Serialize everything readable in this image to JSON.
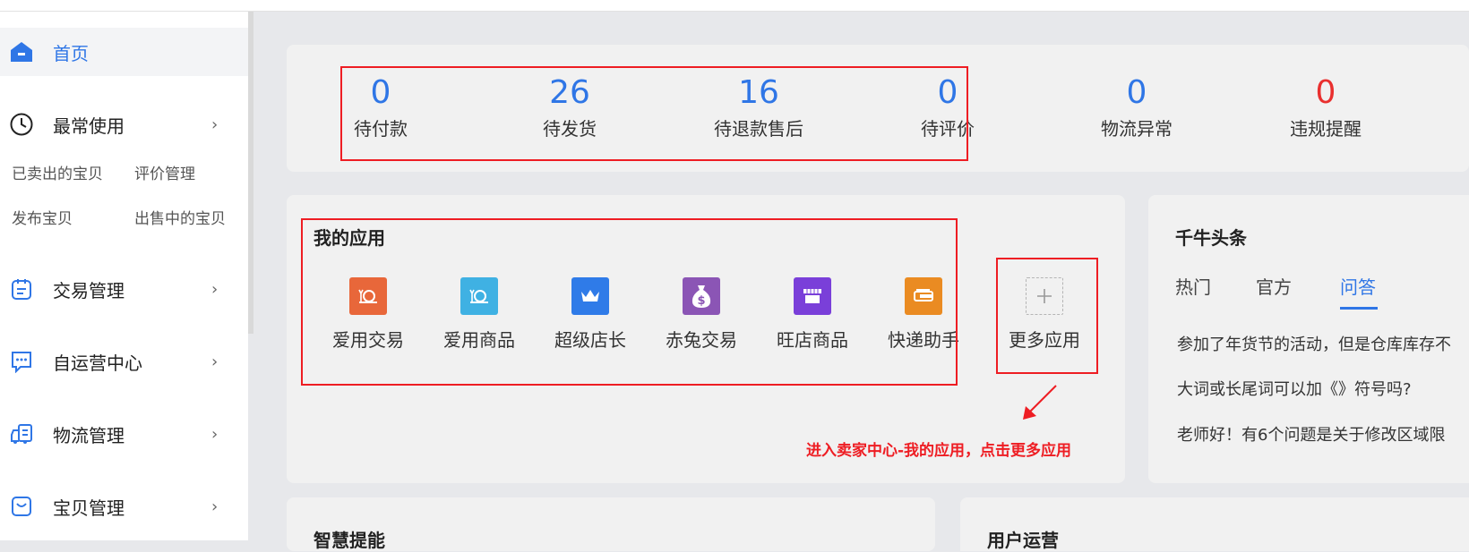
{
  "sidebar": {
    "home": "首页",
    "frequent": "最常使用",
    "quick_links": [
      "已卖出的宝贝",
      "评价管理",
      "发布宝贝",
      "出售中的宝贝"
    ],
    "trade": "交易管理",
    "self_ops": "自运营中心",
    "logistics": "物流管理",
    "goods": "宝贝管理",
    "chevron": "›"
  },
  "stats": [
    {
      "value": "0",
      "label": "待付款"
    },
    {
      "value": "26",
      "label": "待发货"
    },
    {
      "value": "16",
      "label": "待退款售后"
    },
    {
      "value": "0",
      "label": "待评价"
    },
    {
      "value": "0",
      "label": "物流异常"
    },
    {
      "value": "0",
      "label": "违规提醒"
    }
  ],
  "apps": {
    "title": "我的应用",
    "items": [
      "爱用交易",
      "爱用商品",
      "超级店长",
      "赤兔交易",
      "旺店商品",
      "快递助手",
      "更多应用"
    ],
    "colors": [
      "#e8673a",
      "#3fb1e3",
      "#2f7be8",
      "#8b55b5",
      "#7a3fd9",
      "#ea8b22"
    ]
  },
  "annotation": "进入卖家中心-我的应用，点击更多应用",
  "news": {
    "title": "千牛头条",
    "tabs": [
      "热门",
      "官方",
      "问答"
    ],
    "items": [
      "参加了年货节的活动，但是仓库库存不",
      "大词或长尾词可以加《》符号吗?",
      "老师好！有6个问题是关于修改区域限"
    ]
  },
  "bottom": {
    "left_title": "智慧提能",
    "right_title": "用户运营"
  },
  "colors": {
    "accent": "#2f76e6",
    "alert": "#e9302f",
    "annotation": "#ee1d23"
  }
}
